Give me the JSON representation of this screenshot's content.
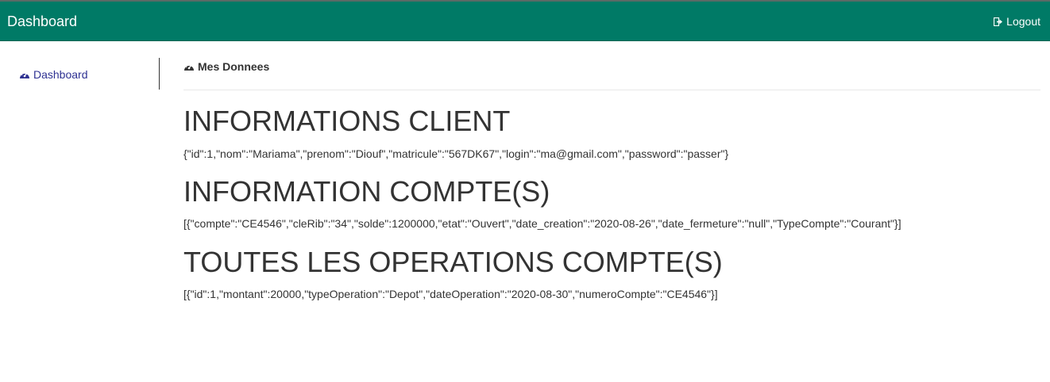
{
  "navbar": {
    "brand": "Dashboard",
    "logout_label": "Logout",
    "background": "#007a66"
  },
  "sidebar": {
    "items": [
      {
        "label": "Dashboard",
        "icon": "dashboard-icon",
        "color": "#2e3192"
      }
    ]
  },
  "main": {
    "header": "Mes Donnees",
    "header_icon": "dashboard-icon",
    "sections": [
      {
        "title": "INFORMATIONS CLIENT",
        "content": "{\"id\":1,\"nom\":\"Mariama\",\"prenom\":\"Diouf\",\"matricule\":\"567DK67\",\"login\":\"ma@gmail.com\",\"password\":\"passer\"}"
      },
      {
        "title": "INFORMATION COMPTE(S)",
        "content": "[{\"compte\":\"CE4546\",\"cleRib\":\"34\",\"solde\":1200000,\"etat\":\"Ouvert\",\"date_creation\":\"2020-08-26\",\"date_fermeture\":\"null\",\"TypeCompte\":\"Courant\"}]"
      },
      {
        "title": "TOUTES LES OPERATIONS COMPTE(S)",
        "content": "[{\"id\":1,\"montant\":20000,\"typeOperation\":\"Depot\",\"dateOperation\":\"2020-08-30\",\"numeroCompte\":\"CE4546\"}]"
      }
    ]
  }
}
